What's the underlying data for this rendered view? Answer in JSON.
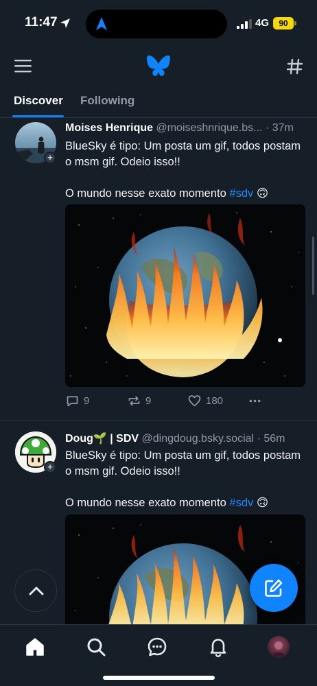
{
  "status_bar": {
    "time": "11:47",
    "network": "4G",
    "battery": "90"
  },
  "tabs": [
    {
      "label": "Discover",
      "active": true
    },
    {
      "label": "Following",
      "active": false
    }
  ],
  "posts": [
    {
      "author": "Moises Henrique",
      "handle": "@moiseshnrique.bs...",
      "separator": "·",
      "time": "37m",
      "text_line1": "BlueSky é tipo: Um posta um gif, todos postam o msm gif. Odeio isso!!",
      "text_line2": "O mundo nesse exato momento",
      "hashtag": "#sdv",
      "emoji": "🙃",
      "media": "burning-earth-gif",
      "replies": "9",
      "reposts": "9",
      "likes": "180"
    },
    {
      "author": "Doug🌱 | SDV",
      "handle": "@dingdoug.bsky.social",
      "separator": "·",
      "time": "56m",
      "text_line1": "BlueSky é tipo: Um posta um gif, todos postam o msm gif. Odeio isso!!",
      "text_line2": "O mundo nesse exato momento",
      "hashtag": "#sdv",
      "emoji": "🙃",
      "media": "burning-earth-gif"
    }
  ],
  "icons": {
    "menu": "hamburger-menu-icon",
    "logo": "bluesky-butterfly-icon",
    "feeds": "hashtag-icon",
    "scroll_top": "chevron-up-icon",
    "compose": "compose-icon",
    "nav": [
      "home-icon",
      "search-icon",
      "chat-icon",
      "bell-icon",
      "profile-avatar"
    ]
  },
  "colors": {
    "background": "#161e27",
    "accent": "#1083fe",
    "muted": "#8f9ba8",
    "battery": "#f5d90a"
  }
}
